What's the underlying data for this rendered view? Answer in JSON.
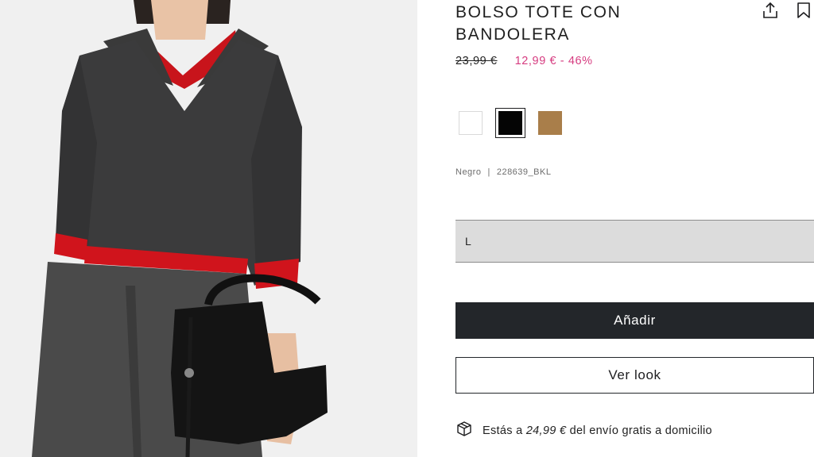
{
  "product": {
    "title": "BOLSO TOTE CON BANDOLERA",
    "old_price": "23,99 €",
    "new_price": "12,99 € - 46%",
    "color_name": "Negro",
    "separator": "|",
    "reference": "228639_BKL",
    "selected_size": "L"
  },
  "swatches": [
    {
      "name": "white",
      "color": "#ffffff",
      "selected": false
    },
    {
      "name": "black",
      "color": "#050505",
      "selected": true
    },
    {
      "name": "tan",
      "color": "#a97e4a",
      "selected": false
    }
  ],
  "actions": {
    "add_label": "Añadir",
    "look_label": "Ver look",
    "share_icon": "share-icon",
    "save_icon": "bookmark-icon"
  },
  "shipping": {
    "prefix": "Estás a",
    "amount": "24,99 €",
    "suffix": "del envío gratis a domicilio",
    "icon": "package-icon"
  },
  "colors": {
    "sale_price": "#d63c80",
    "button_dark": "#23262a",
    "size_bg": "#dcdcdc"
  }
}
